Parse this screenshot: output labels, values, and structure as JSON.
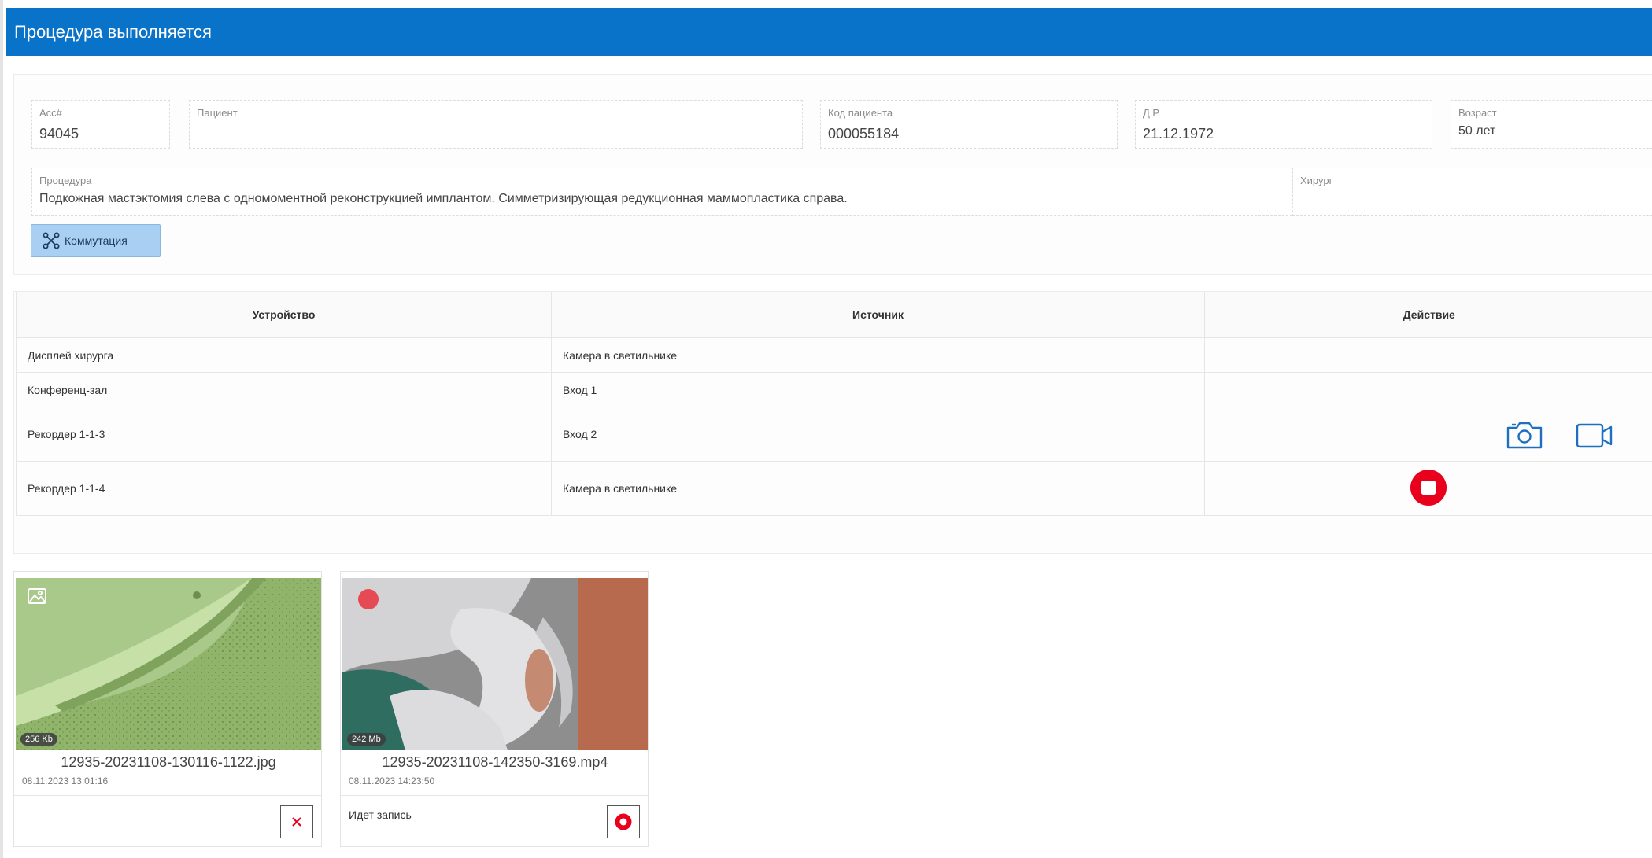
{
  "header": {
    "title": "Процедура выполняется"
  },
  "patient": {
    "acc_label": "Acc#",
    "acc_value": "94045",
    "patient_label": "Пациент",
    "patient_value": "",
    "code_label": "Код пациента",
    "code_value": "000055184",
    "dob_label": "Д.Р.",
    "dob_value": "21.12.1972",
    "age_label": "Возраст",
    "age_value": "50 лет",
    "procedure_label": "Процедура",
    "procedure_value": "Подкожная мастэктомия слева с одномоментной реконструкцией имплантом. Симметризирующая редукционная маммопластика справа.",
    "surgeon_label": "Хирург",
    "surgeon_value": ""
  },
  "buttons": {
    "commutation_label": "Коммутация"
  },
  "table": {
    "headers": [
      "Устройство",
      "Источник",
      "Действие"
    ],
    "rows": [
      {
        "device": "Дисплей хирурга",
        "source": "Камера в светильнике"
      },
      {
        "device": "Конференц-зал",
        "source": "Вход 1"
      },
      {
        "device": "Рекордер 1-1-3",
        "source": "Вход 2"
      },
      {
        "device": "Рекордер 1-1-4",
        "source": "Камера в светильнике"
      }
    ]
  },
  "files": [
    {
      "size": "256 Kb",
      "name": "12935-20231108-130116-1122.jpg",
      "date": "08.11.2023 13:01:16",
      "status": ""
    },
    {
      "size": "242 Mb",
      "name": "12935-20231108-142350-3169.mp4",
      "date": "08.11.2023 14:23:50",
      "status": "Идет запись"
    }
  ],
  "colors": {
    "accent": "#0972c9",
    "record_red": "#e8001c",
    "icon_blue": "#1f6fc0"
  }
}
